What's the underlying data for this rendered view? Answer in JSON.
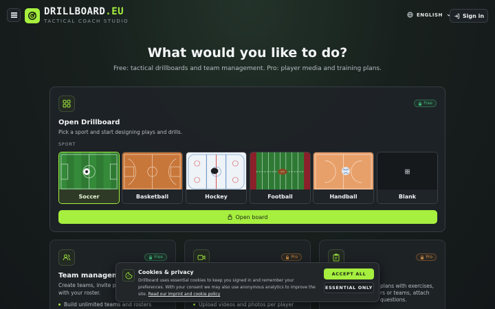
{
  "header": {
    "brand_name": "DRILLBOARD",
    "brand_tld": ".EU",
    "tagline": "TACTICAL COACH STUDIO",
    "language": "ENGLISH",
    "signin_label": "Sign in",
    "accent": "#a6ef3f"
  },
  "hero": {
    "title": "What would you like to do?",
    "subtitle": "Free: tactical drillboards and team management. Pro: player media and training plans."
  },
  "drillboard_card": {
    "badge": "Free",
    "title": "Open Drillboard",
    "description": "Pick a sport and start designing plays and drills.",
    "sport_label": "SPORT",
    "sports": [
      {
        "label": "Soccer",
        "icon": "soccer-ball-icon",
        "selected": true
      },
      {
        "label": "Basketball",
        "icon": "basketball-court-icon",
        "selected": false
      },
      {
        "label": "Hockey",
        "icon": "hockey-puck-icon",
        "selected": false
      },
      {
        "label": "Football",
        "icon": "football-icon",
        "selected": false
      },
      {
        "label": "Handball",
        "icon": "handball-icon",
        "selected": false
      },
      {
        "label": "Blank",
        "icon": "grid-icon",
        "selected": false
      }
    ],
    "open_button": "Open board"
  },
  "team_card": {
    "badge": "Free",
    "title": "Team management",
    "description_1": "Create teams, invite pla",
    "description_2": "with your roster.",
    "bullet_1": "Build unlimited teams and rosters"
  },
  "media_card": {
    "badge": "Pro",
    "bullet_1": "Upload videos and photos per player"
  },
  "plans_card": {
    "badge": "Pro",
    "line_1": "plans with exercises,",
    "line_2": "rs or teams, attach",
    "line_3": "questions."
  },
  "cookie_banner": {
    "title": "Cookies & privacy",
    "text_1": "Drillboard uses essential cookies to keep you signed in and remember your preferences. With your consent we may also use anonymous analytics to improve the site.",
    "link": "Read our imprint and cookie policy",
    "accept_label": "ACCEPT ALL",
    "essential_label": "ESSENTIAL ONLY"
  }
}
